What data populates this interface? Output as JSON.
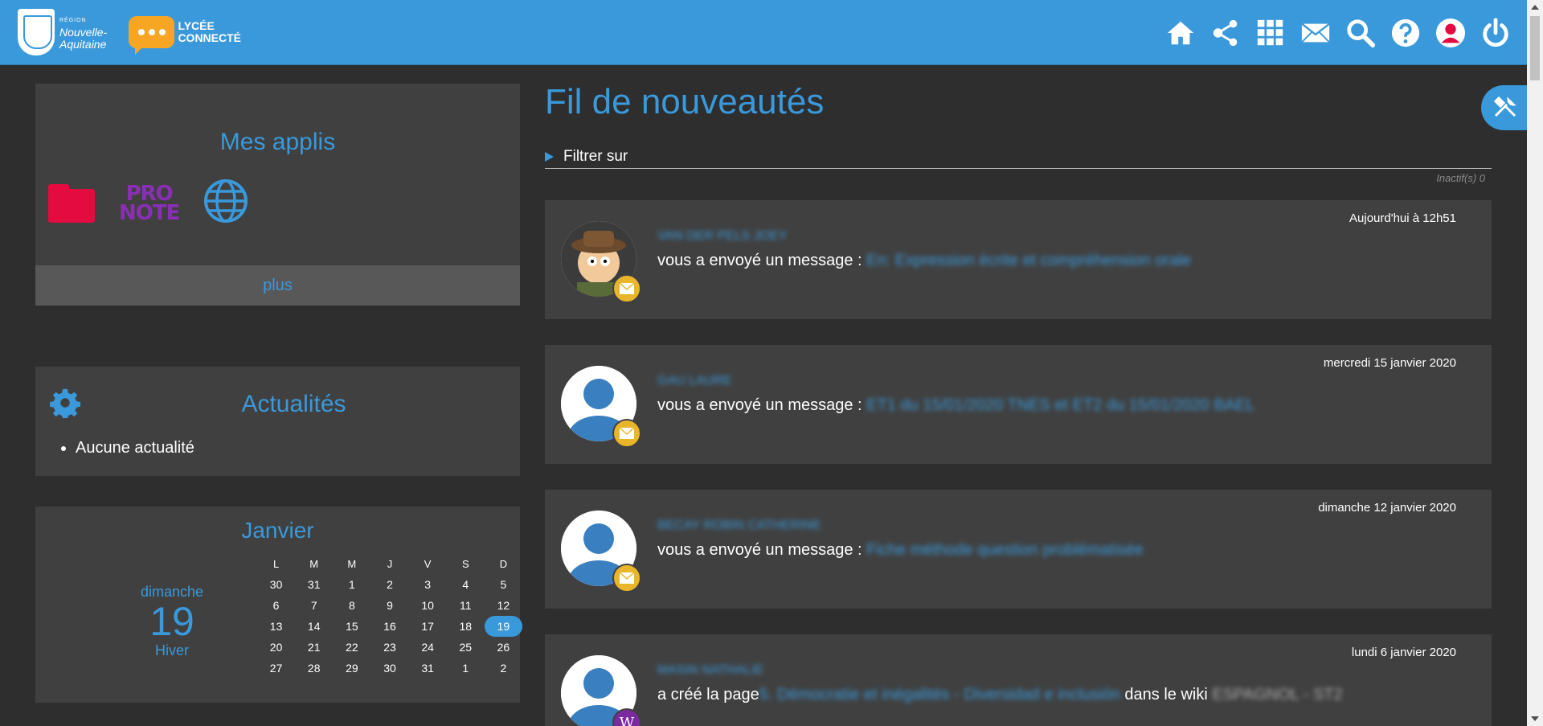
{
  "header": {
    "region_small": "RÉGION",
    "region_name_1": "Nouvelle-",
    "region_name_2": "Aquitaine",
    "lycee_1": "LYCÉE",
    "lycee_2": "CONNECTÉ",
    "icons": [
      "home-icon",
      "share-icon",
      "apps-grid-icon",
      "mail-icon",
      "search-icon",
      "help-icon",
      "user-icon",
      "power-icon"
    ],
    "accent": "#3a99db"
  },
  "apps": {
    "title": "Mes applis",
    "items": [
      "folder-icon",
      "pronote",
      "globe-icon"
    ],
    "pronote_line1": "PRO",
    "pronote_line2": "NOTE",
    "more": "plus"
  },
  "news": {
    "title": "Actualités",
    "empty": "Aucune actualité"
  },
  "calendar": {
    "month": "Janvier",
    "day_name": "dimanche",
    "day_num": "19",
    "season": "Hiver",
    "headers": [
      "L",
      "M",
      "M",
      "J",
      "V",
      "S",
      "D"
    ],
    "weeks": [
      [
        "30",
        "31",
        "1",
        "2",
        "3",
        "4",
        "5"
      ],
      [
        "6",
        "7",
        "8",
        "9",
        "10",
        "11",
        "12"
      ],
      [
        "13",
        "14",
        "15",
        "16",
        "17",
        "18",
        "19"
      ],
      [
        "20",
        "21",
        "22",
        "23",
        "24",
        "25",
        "26"
      ],
      [
        "27",
        "28",
        "29",
        "30",
        "31",
        "1",
        "2"
      ]
    ],
    "today": "19"
  },
  "feed": {
    "title": "Fil de nouveautés",
    "filter_label": "Filtrer sur",
    "inactive": "Inactif(s) 0",
    "items": [
      {
        "date": "Aujourd'hui à 12h51",
        "sender": "VAN DER PELS JOEY",
        "action": "vous a envoyé un message : ",
        "subject": "En: Expression écrite et compréhension orale",
        "badge": "mail-icon",
        "avatar": "photo"
      },
      {
        "date": "mercredi 15 janvier 2020",
        "sender": "GAU LAURE",
        "action": "vous a envoyé un message : ",
        "subject": "ET1 du 15/01/2020 TNES et ET2 du 15/01/2020 BAEL",
        "badge": "mail-icon",
        "avatar": "default"
      },
      {
        "date": "dimanche 12 janvier 2020",
        "sender": "BECAY ROBIN CATHERINE",
        "action": "vous a envoyé un message : ",
        "subject": "Fiche méthode question problématisée",
        "badge": "mail-icon",
        "avatar": "default"
      },
      {
        "date": "lundi 6 janvier 2020",
        "sender": "MASIN NATHALIE",
        "action": "a créé la page",
        "subject": "5. Démocratie et inégalités - Diversidad e inclusión",
        "action2": " dans le wiki ",
        "wiki": "ESPAGNOL - ST2",
        "badge": "wiki-icon",
        "badge_text": "W",
        "avatar": "default"
      }
    ]
  }
}
